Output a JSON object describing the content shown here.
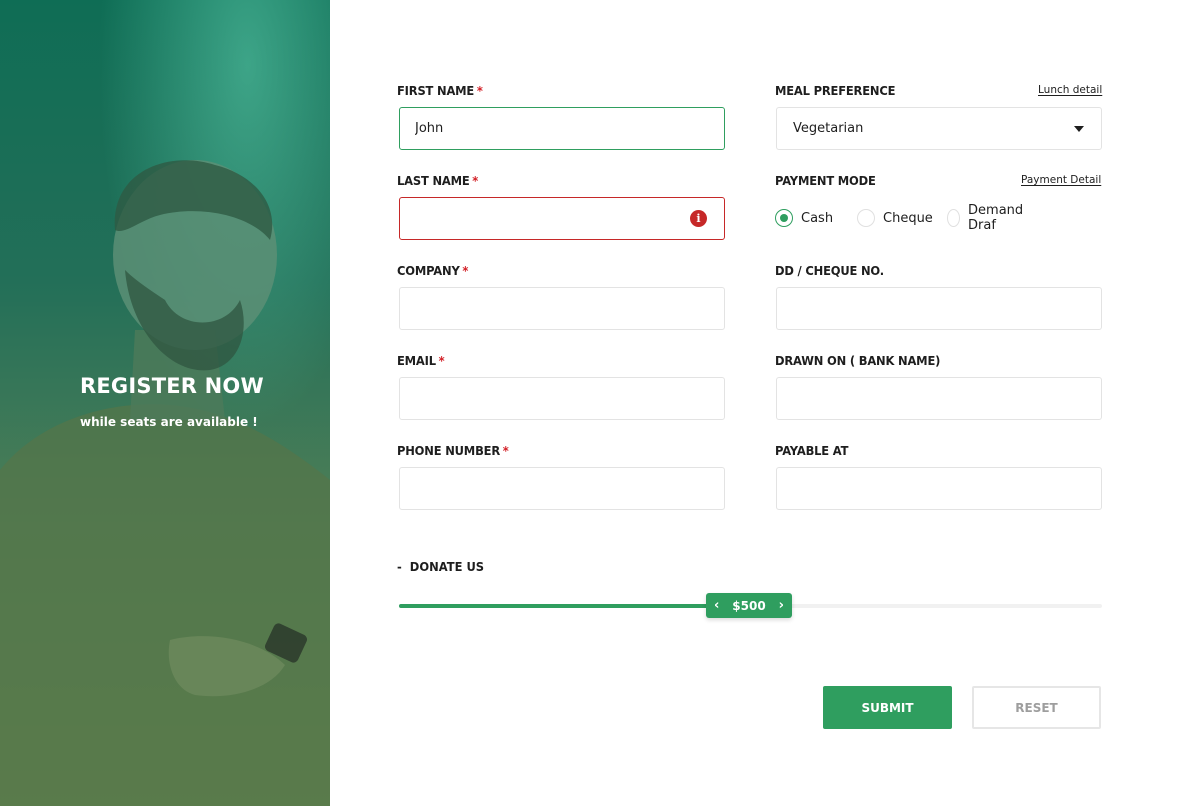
{
  "hero": {
    "title": "REGISTER NOW",
    "subtitle": "while seats are available !"
  },
  "form": {
    "first_name": {
      "label": "FIRST NAME",
      "required_mark": "*",
      "value": "John",
      "state": "valid"
    },
    "last_name": {
      "label": "LAST NAME",
      "required_mark": "*",
      "value": "",
      "state": "error",
      "error_icon": "i"
    },
    "company": {
      "label": "COMPANY",
      "required_mark": "*",
      "value": ""
    },
    "email": {
      "label": "EMAIL",
      "required_mark": "*",
      "value": ""
    },
    "phone": {
      "label": "PHONE NUMBER",
      "required_mark": "*",
      "value": ""
    },
    "meal": {
      "label": "MEAL PREFERENCE",
      "link": "Lunch detail",
      "selected": "Vegetarian"
    },
    "payment": {
      "label": "PAYMENT MODE",
      "link": "Payment Detail",
      "options": [
        "Cash",
        "Cheque",
        "Demand Draf"
      ],
      "selected": "Cash"
    },
    "dd_cheque": {
      "label": "DD / CHEQUE NO.",
      "value": ""
    },
    "drawn_on": {
      "label": "DRAWN ON ( BANK NAME)",
      "value": ""
    },
    "payable_at": {
      "label": "PAYABLE AT",
      "value": ""
    }
  },
  "donate": {
    "toggle": "-",
    "label": "DONATE US",
    "value_label": "$500",
    "fill_fraction": 0.45,
    "prev_icon": "‹",
    "next_icon": "›"
  },
  "buttons": {
    "submit": "SUBMIT",
    "reset": "RESET"
  },
  "colors": {
    "accent": "#2f9e5f",
    "error": "#c62828",
    "required": "#d32027"
  }
}
